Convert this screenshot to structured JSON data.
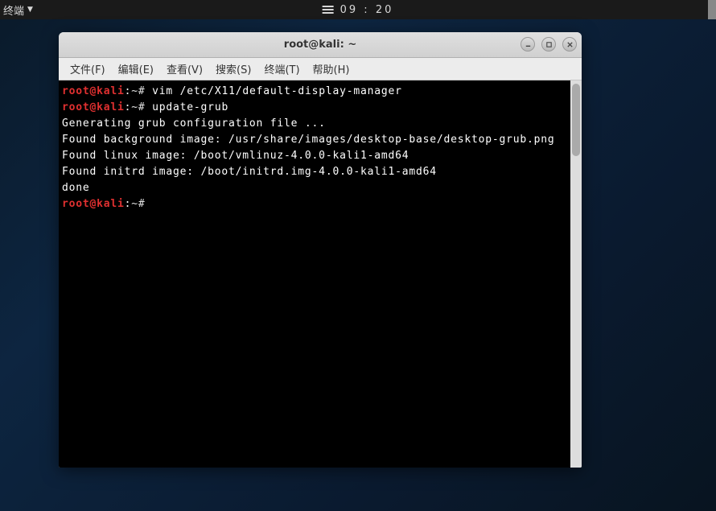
{
  "top_bar": {
    "app_label": "终端",
    "time": "09 : 20"
  },
  "window": {
    "title": "root@kali: ~",
    "menubar": {
      "file": "文件(F)",
      "edit": "编辑(E)",
      "view": "查看(V)",
      "search": "搜索(S)",
      "terminal": "终端(T)",
      "help": "帮助(H)"
    },
    "controls": {
      "minimize": "minimize-icon",
      "maximize": "maximize-icon",
      "close": "close-icon"
    }
  },
  "terminal": {
    "prompt_user": "root@kali",
    "prompt_sep": ":",
    "prompt_path": "~#",
    "lines": {
      "l0_cmd": " vim /etc/X11/default-display-manager",
      "l1_cmd": " update-grub",
      "l2": "Generating grub configuration file ...",
      "l3": "Found background image: /usr/share/images/desktop-base/desktop-grub.png",
      "l4": "Found linux image: /boot/vmlinuz-4.0.0-kali1-amd64",
      "l5": "Found initrd image: /boot/initrd.img-4.0.0-kali1-amd64",
      "l6": "done",
      "l7_cmd": " "
    }
  }
}
